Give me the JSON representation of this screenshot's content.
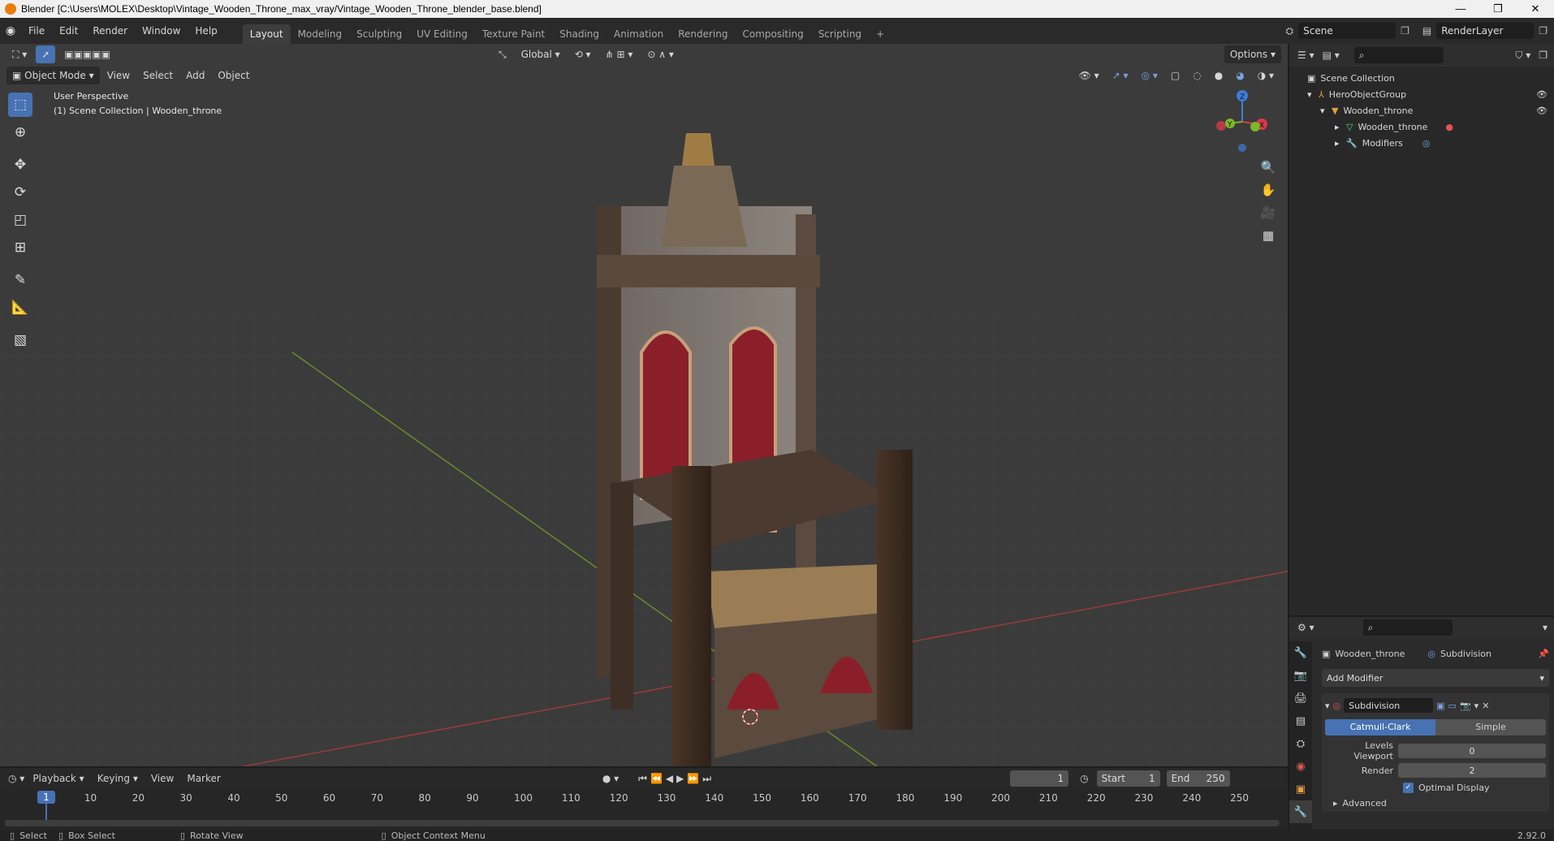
{
  "window": {
    "title": "Blender [C:\\Users\\MOLEX\\Desktop\\Vintage_Wooden_Throne_max_vray/Vintage_Wooden_Throne_blender_base.blend]",
    "controls": [
      "—",
      "❐",
      "✕"
    ]
  },
  "menubar": {
    "menus": [
      "File",
      "Edit",
      "Render",
      "Window",
      "Help"
    ],
    "workspaces": [
      "Layout",
      "Modeling",
      "Sculpting",
      "UV Editing",
      "Texture Paint",
      "Shading",
      "Animation",
      "Rendering",
      "Compositing",
      "Scripting"
    ],
    "active_workspace": "Layout",
    "add_tab": "+",
    "scene": "Scene",
    "render_layer": "RenderLayer"
  },
  "viewport_header": {
    "mode": "Object Mode",
    "menus": [
      "View",
      "Select",
      "Add",
      "Object"
    ],
    "orientation": "Global",
    "options": "Options"
  },
  "viewport": {
    "perspective": "User Perspective",
    "collection_info": "(1) Scene Collection | Wooden_throne",
    "gizmo": {
      "x": "X",
      "y": "Y",
      "z": "Z"
    }
  },
  "outliner": {
    "root": "Scene Collection",
    "items": [
      {
        "label": "HeroObjectGroup",
        "indent": 1
      },
      {
        "label": "Wooden_throne",
        "indent": 2
      },
      {
        "label": "Wooden_throne",
        "indent": 3
      },
      {
        "label": "Modifiers",
        "indent": 3
      }
    ]
  },
  "properties": {
    "object": "Wooden_throne",
    "modifier_context": "Subdivision",
    "add_modifier": "Add Modifier",
    "modifier_name": "Subdivision",
    "type_options": [
      "Catmull-Clark",
      "Simple"
    ],
    "active_type": "Catmull-Clark",
    "levels_viewport_label": "Levels Viewport",
    "levels_viewport": "0",
    "render_label": "Render",
    "render": "2",
    "optimal_display": "Optimal Display",
    "advanced": "Advanced"
  },
  "timeline": {
    "menus": [
      "Playback",
      "Keying",
      "View",
      "Marker"
    ],
    "current_frame": "1",
    "start_label": "Start",
    "start": "1",
    "end_label": "End",
    "end": "250",
    "ticks": [
      "1",
      "10",
      "20",
      "30",
      "40",
      "50",
      "60",
      "70",
      "80",
      "90",
      "100",
      "110",
      "120",
      "130",
      "140",
      "150",
      "160",
      "170",
      "180",
      "190",
      "200",
      "210",
      "220",
      "230",
      "240",
      "250"
    ]
  },
  "statusbar": {
    "select": "Select",
    "box_select": "Box Select",
    "rotate_view": "Rotate View",
    "context_menu": "Object Context Menu",
    "version": "2.92.0"
  }
}
